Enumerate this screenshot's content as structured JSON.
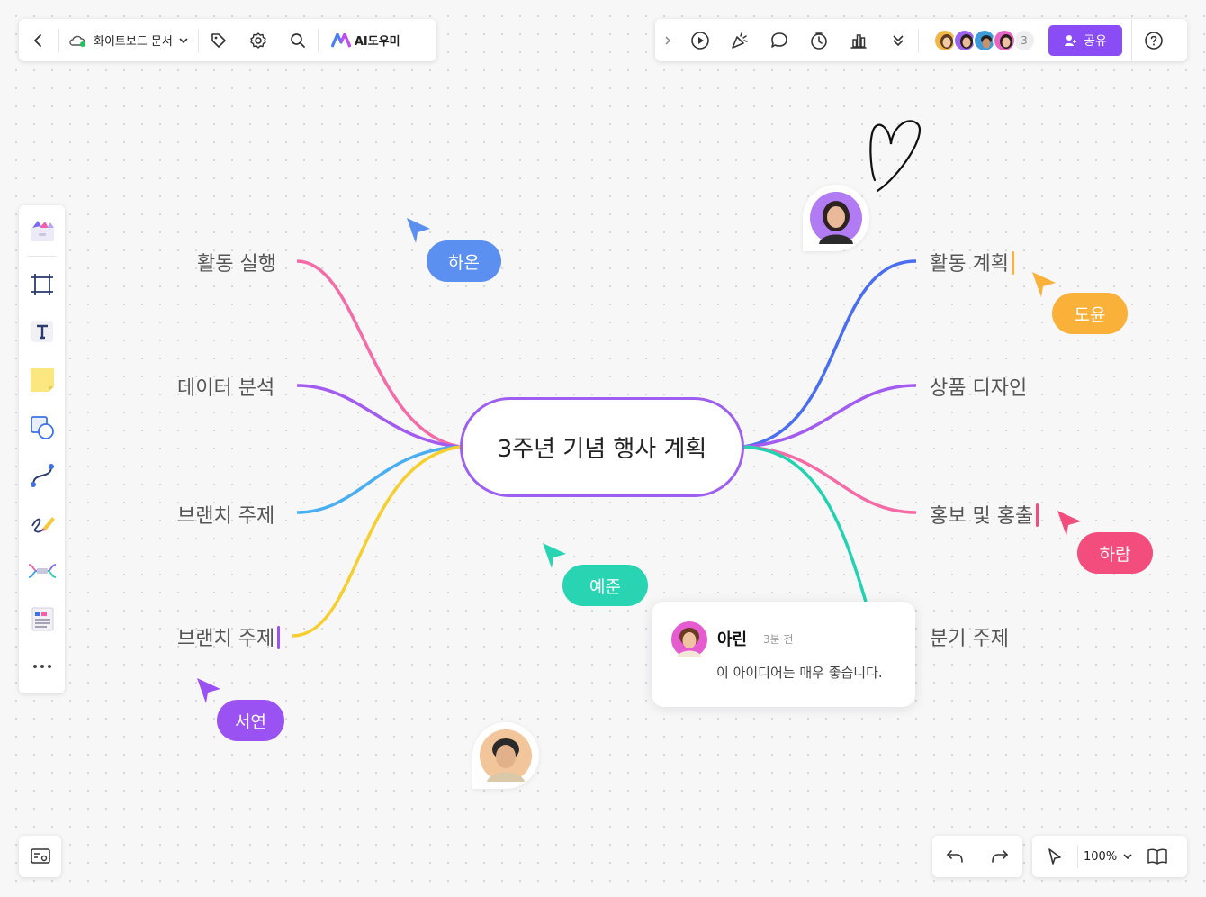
{
  "toolbar_left": {
    "back_icon": "chevron-left-icon",
    "doc_title": "화이트보드 문서",
    "tag_icon": "tag-icon",
    "settings_icon": "gear-icon",
    "search_icon": "search-icon",
    "ai_label": "AI도우미"
  },
  "toolbar_right": {
    "collaborator_count": "3",
    "share_label": "공유",
    "help_icon": "question-icon"
  },
  "mindmap": {
    "central": "3주년 기념 행사 계획",
    "left_branches": [
      "활동 실행",
      "데이터 분석",
      "브랜치 주제",
      "브랜치 주제"
    ],
    "right_branches": [
      "활동 계획",
      "상품 디자인",
      "홍보 및 홍출",
      "분기 주제"
    ],
    "colors": {
      "pink": "#f46ba6",
      "purple": "#a25cf0",
      "blue": "#4aaef0",
      "yellow": "#f6cf2f",
      "royal": "#4a6ef0",
      "teal": "#23d3b0",
      "central_border": "#9d5ff1"
    }
  },
  "cursors": [
    {
      "name": "하온",
      "color": "#5b8ff0"
    },
    {
      "name": "도윤",
      "color": "#f9b13a"
    },
    {
      "name": "하람",
      "color": "#f24d7d"
    },
    {
      "name": "예준",
      "color": "#28d4b1"
    },
    {
      "name": "서연",
      "color": "#9b52f2"
    }
  ],
  "comment": {
    "author": "아린",
    "time": "3분 전",
    "text": "이 아이디어는 매우 좋습니다."
  },
  "bottom": {
    "zoom": "100%"
  },
  "accent_color": "#8a4cf4"
}
